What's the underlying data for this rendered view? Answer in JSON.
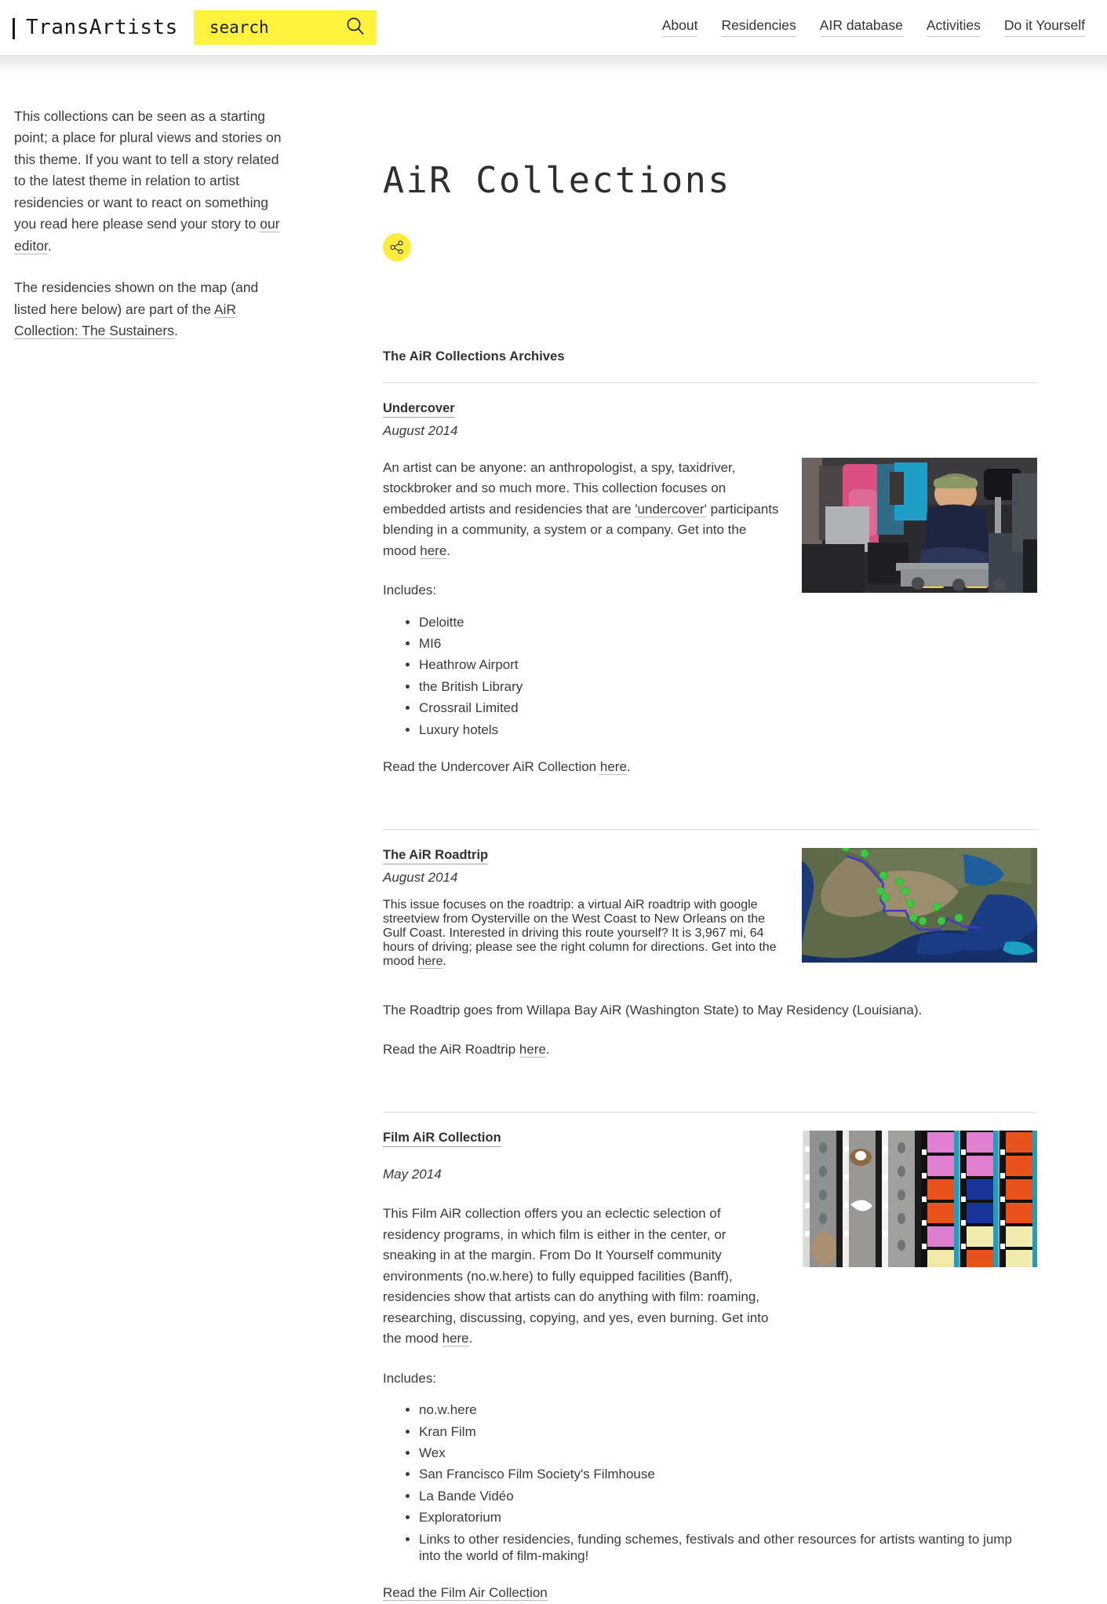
{
  "header": {
    "brand": "TransArtists",
    "brand_prefix_icon": "vertical-bar-icon",
    "search": {
      "placeholder": "search",
      "value": "",
      "icon": "search-icon"
    },
    "nav": [
      {
        "label": "About"
      },
      {
        "label": "Residencies"
      },
      {
        "label": "AIR database"
      },
      {
        "label": "Activities"
      },
      {
        "label": "Do it Yourself"
      }
    ]
  },
  "sidebar": {
    "paragraph1_before": "This collections can be seen as a starting point; a place for plural views and stories on this theme. If you want to tell a story related to the latest theme in relation to artist residencies or want to react on something you read here please send your story to ",
    "paragraph1_link": "our editor",
    "paragraph1_after": ".",
    "paragraph2_before": "The residencies shown on the map (and listed here below) are part of the ",
    "paragraph2_link": "AiR Collection: The Sustainers",
    "paragraph2_after": "."
  },
  "main": {
    "title": "AiR Collections",
    "share_icon": "share-icon",
    "archives_heading": "The AiR Collections Archives",
    "collections": [
      {
        "title": "Undercover",
        "date": "August 2014",
        "intro_part1": "An artist can be anyone: an anthropologist, a spy, taxidriver, stockbroker and so much more. This collection focuses on embedded artists and residencies that are ",
        "intro_link1": "'undercover'",
        "intro_part2": " participants blending in a community, a system or a company. Get into the mood ",
        "intro_link2": "here",
        "intro_part3": ".",
        "includes_label": "Includes:",
        "includes": [
          "Deloitte",
          "MI6",
          "Heathrow Airport",
          "the British Library",
          "Crossrail Limited",
          "Luxury hotels"
        ],
        "read_before": "Read the Undercover AiR Collection ",
        "read_link": "here",
        "read_after": ".",
        "image_alt": "man-sitting-on-luggage-trolley-at-airport"
      },
      {
        "title": "The AiR Roadtrip",
        "date": "August 2014",
        "intro_part1": "This issue focuses on the roadtrip: a virtual AiR roadtrip with google streetview from Oysterville on the West Coast to New Orleans on the Gulf Coast. Interested in driving this route yourself? It is 3,967 mi, 64 hours of driving; please see the right column for directions. Get into the mood ",
        "intro_link1": "here",
        "intro_part2": ".",
        "note": "The Roadtrip goes from Willapa Bay AiR (Washington State) to May Residency (Louisiana).",
        "read_before": "Read the AiR Roadtrip ",
        "read_link": "here",
        "read_after": ".",
        "image_alt": "satellite-map-of-usa-with-route-markers-a-to-m"
      },
      {
        "title": "Film AiR Collection",
        "date": "May 2014",
        "intro_part1": "This Film AiR collection offers you an eclectic selection of residency programs, in which film is either in the center, or sneaking in at the margin. From Do It Yourself community environments (no.w.here) to fully equipped facilities (Banff), residencies show that artists can do anything with film: roaming, researching, discussing, copying, and yes, even burning. Get into the mood ",
        "intro_link1": "here",
        "intro_part2": ".",
        "includes_label": "Includes:",
        "includes": [
          "no.w.here",
          "Kran Film",
          "Wex",
          "San Francisco Film Society's Filmhouse",
          "La Bande Vidéo",
          "Exploratorium",
          "Links to other residencies, funding schemes, festivals and other resources for artists wanting to jump into the world of film-making!"
        ],
        "read_link_full": "Read the Film Air Collection",
        "image_alt": "strips-of-35mm-film-in-color-and-black-and-white"
      }
    ]
  },
  "colors": {
    "search_yellow": "#fff23f",
    "share_yellow": "#ffec3d",
    "text": "#373b3d"
  }
}
